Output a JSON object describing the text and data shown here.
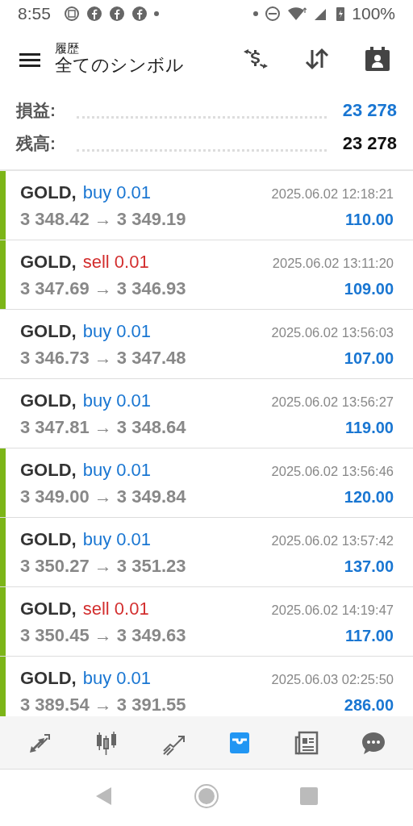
{
  "status_bar": {
    "time": "8:55",
    "battery": "100%"
  },
  "header": {
    "subtitle": "履歴",
    "title": "全てのシンボル"
  },
  "summary": [
    {
      "label": "損益:",
      "value": "23 278",
      "kind": "profit"
    },
    {
      "label": "残高:",
      "value": "23 278",
      "kind": "balance"
    }
  ],
  "deals": [
    {
      "symbol": "GOLD,",
      "side": "buy",
      "volume": "0.01",
      "prices": "3 348.42 → 3 349.19",
      "time": "2025.06.02 12:18:21",
      "profit": "110.00",
      "marked": true
    },
    {
      "symbol": "GOLD,",
      "side": "sell",
      "volume": "0.01",
      "prices": "3 347.69 → 3 346.93",
      "time": "2025.06.02 13:11:20",
      "profit": "109.00",
      "marked": true
    },
    {
      "symbol": "GOLD,",
      "side": "buy",
      "volume": "0.01",
      "prices": "3 346.73 → 3 347.48",
      "time": "2025.06.02 13:56:03",
      "profit": "107.00",
      "marked": false
    },
    {
      "symbol": "GOLD,",
      "side": "buy",
      "volume": "0.01",
      "prices": "3 347.81 → 3 348.64",
      "time": "2025.06.02 13:56:27",
      "profit": "119.00",
      "marked": false
    },
    {
      "symbol": "GOLD,",
      "side": "buy",
      "volume": "0.01",
      "prices": "3 349.00 → 3 349.84",
      "time": "2025.06.02 13:56:46",
      "profit": "120.00",
      "marked": true
    },
    {
      "symbol": "GOLD,",
      "side": "buy",
      "volume": "0.01",
      "prices": "3 350.27 → 3 351.23",
      "time": "2025.06.02 13:57:42",
      "profit": "137.00",
      "marked": true
    },
    {
      "symbol": "GOLD,",
      "side": "sell",
      "volume": "0.01",
      "prices": "3 350.45 → 3 349.63",
      "time": "2025.06.02 14:19:47",
      "profit": "117.00",
      "marked": true
    },
    {
      "symbol": "GOLD,",
      "side": "buy",
      "volume": "0.01",
      "prices": "3 389.54 → 3 391.55",
      "time": "2025.06.03 02:25:50",
      "profit": "286.00",
      "marked": true
    }
  ],
  "bottom_nav": [
    {
      "kind": "quotes",
      "selected": false
    },
    {
      "kind": "chart",
      "selected": false
    },
    {
      "kind": "trade",
      "selected": false
    },
    {
      "kind": "history",
      "selected": true
    },
    {
      "kind": "news",
      "selected": false
    },
    {
      "kind": "chat",
      "selected": false
    }
  ]
}
